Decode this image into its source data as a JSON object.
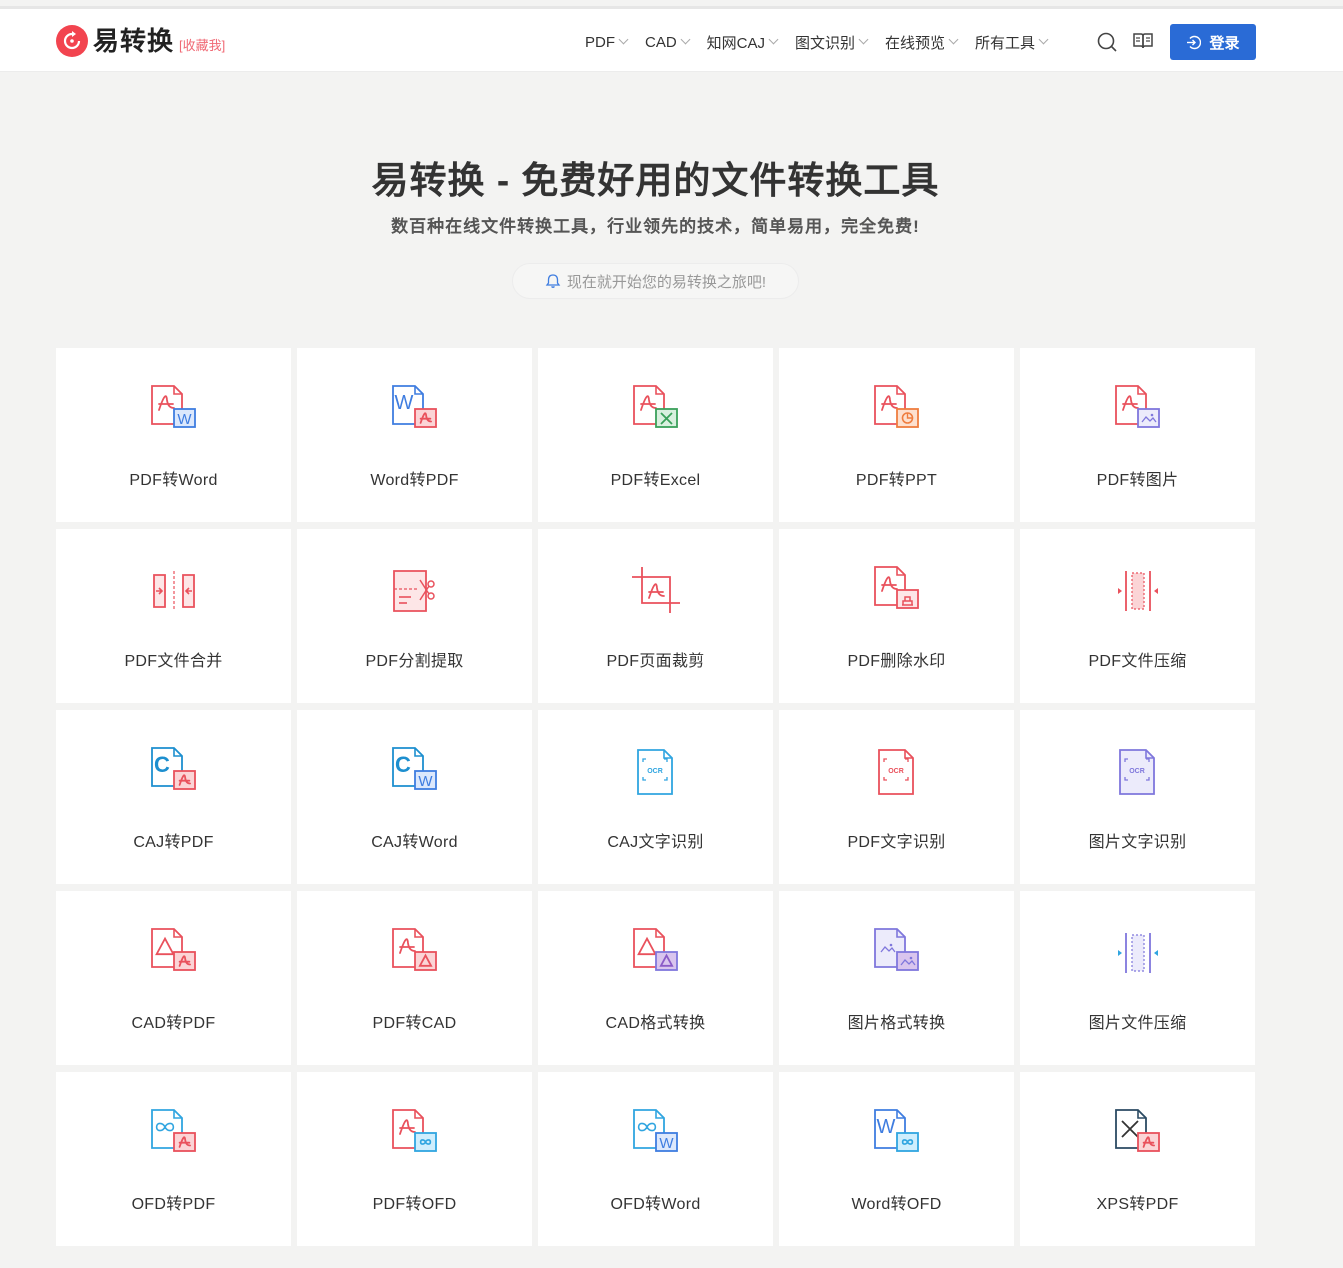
{
  "header": {
    "logo_name": "易转换",
    "bookmark_label": "[收藏我]",
    "nav": [
      "PDF",
      "CAD",
      "知网CAJ",
      "图文识别",
      "在线预览",
      "所有工具"
    ],
    "login_label": "登录"
  },
  "hero": {
    "title": "易转换 - 免费好用的文件转换工具",
    "subtitle": "数百种在线文件转换工具，行业领先的技术，简单易用，完全免费!",
    "pill": "现在就开始您的易转换之旅吧!"
  },
  "colors": {
    "brand_red": "#f2444f",
    "login_blue": "#2a6bd6",
    "pdf_red": "#e9515c",
    "word_blue": "#3f7de0",
    "excel_green": "#3aa05a",
    "ppt_orange": "#ef7d3f",
    "img_purple": "#7f77dc",
    "caj_teal": "#1d8fcf"
  },
  "tools": [
    {
      "label": "PDF转Word",
      "icon": "pdf-to-word-icon"
    },
    {
      "label": "Word转PDF",
      "icon": "word-to-pdf-icon"
    },
    {
      "label": "PDF转Excel",
      "icon": "pdf-to-excel-icon"
    },
    {
      "label": "PDF转PPT",
      "icon": "pdf-to-ppt-icon"
    },
    {
      "label": "PDF转图片",
      "icon": "pdf-to-image-icon"
    },
    {
      "label": "PDF文件合并",
      "icon": "pdf-merge-icon"
    },
    {
      "label": "PDF分割提取",
      "icon": "pdf-split-icon"
    },
    {
      "label": "PDF页面裁剪",
      "icon": "pdf-crop-icon"
    },
    {
      "label": "PDF删除水印",
      "icon": "pdf-remove-watermark-icon"
    },
    {
      "label": "PDF文件压缩",
      "icon": "pdf-compress-icon"
    },
    {
      "label": "CAJ转PDF",
      "icon": "caj-to-pdf-icon"
    },
    {
      "label": "CAJ转Word",
      "icon": "caj-to-word-icon"
    },
    {
      "label": "CAJ文字识别",
      "icon": "caj-ocr-icon"
    },
    {
      "label": "PDF文字识别",
      "icon": "pdf-ocr-icon"
    },
    {
      "label": "图片文字识别",
      "icon": "image-ocr-icon"
    },
    {
      "label": "CAD转PDF",
      "icon": "cad-to-pdf-icon"
    },
    {
      "label": "PDF转CAD",
      "icon": "pdf-to-cad-icon"
    },
    {
      "label": "CAD格式转换",
      "icon": "cad-convert-icon"
    },
    {
      "label": "图片格式转换",
      "icon": "image-convert-icon"
    },
    {
      "label": "图片文件压缩",
      "icon": "image-compress-icon"
    },
    {
      "label": "OFD转PDF",
      "icon": "ofd-to-pdf-icon"
    },
    {
      "label": "PDF转OFD",
      "icon": "pdf-to-ofd-icon"
    },
    {
      "label": "OFD转Word",
      "icon": "ofd-to-word-icon"
    },
    {
      "label": "Word转OFD",
      "icon": "word-to-ofd-icon"
    },
    {
      "label": "XPS转PDF",
      "icon": "xps-to-pdf-icon"
    }
  ]
}
